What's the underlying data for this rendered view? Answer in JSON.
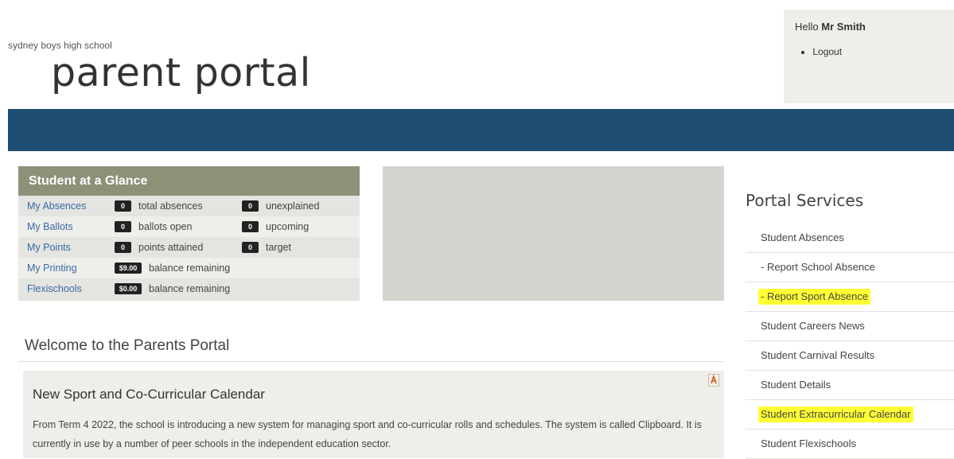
{
  "header": {
    "school_name": "sydney boys high school",
    "portal_title": "parent portal",
    "greeting": "Hello",
    "user_name": "Mr Smith",
    "logout_label": "Logout"
  },
  "colors": {
    "nav_bar": "#1d4d73",
    "glance_header": "#8c9178",
    "link": "#3a6aa8",
    "highlight": "#ffff33"
  },
  "glance": {
    "title": "Student at a Glance",
    "rows": [
      {
        "link": "My Absences",
        "badge1": "0",
        "text1": "total absences",
        "badge2": "0",
        "text2": "unexplained"
      },
      {
        "link": "My Ballots",
        "badge1": "0",
        "text1": "ballots open",
        "badge2": "0",
        "text2": "upcoming"
      },
      {
        "link": "My Points",
        "badge1": "0",
        "text1": "points attained",
        "badge2": "0",
        "text2": "target"
      },
      {
        "link": "My Printing",
        "badge1": "$9.00",
        "text1": "balance remaining"
      },
      {
        "link": "Flexischools",
        "badge1": "$0.00",
        "text1": "balance remaining"
      }
    ]
  },
  "welcome": {
    "heading": "Welcome to the Parents Portal"
  },
  "news": {
    "icon": "pdf-icon",
    "title": "New Sport and Co-Curricular Calendar",
    "body": "From Term 4 2022, the school is introducing a new system for managing sport and co-curricular rolls and schedules. The system is called Clipboard. It is currently in use by a number of peer schools in the independent education sector."
  },
  "services": {
    "title": "Portal Services",
    "items": [
      {
        "label": "Student Absences",
        "highlighted": false
      },
      {
        "label": "- Report School Absence",
        "highlighted": false
      },
      {
        "label": "- Report Sport Absence",
        "highlighted": true
      },
      {
        "label": "Student Careers News",
        "highlighted": false
      },
      {
        "label": "Student Carnival Results",
        "highlighted": false
      },
      {
        "label": "Student Details",
        "highlighted": false
      },
      {
        "label": "Student Extracurricular Calendar",
        "highlighted": true
      },
      {
        "label": "Student Flexischools",
        "highlighted": false
      }
    ]
  }
}
